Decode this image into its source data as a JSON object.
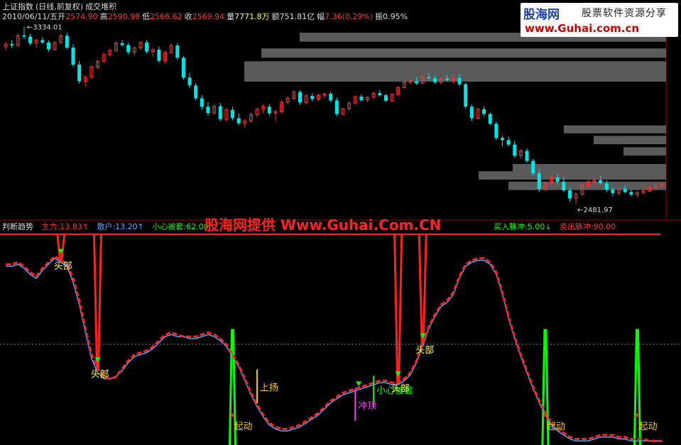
{
  "header": {
    "index_name": "上证指数",
    "mode": "(日线,前复权)",
    "overlay": "成交堆积",
    "date": "2010/06/11/五",
    "open_label": "开",
    "open": "2574.90",
    "high_label": "高",
    "high": "2590.98",
    "low_label": "低",
    "low": "2566.62",
    "close_label": "收",
    "close": "2569.94",
    "volume_label": "量",
    "volume": "7771.8万",
    "amount_label": "额",
    "amount": "751.81亿",
    "change_label": "幅",
    "change": "7.36(0.29%)",
    "amplitude_label": "振",
    "amplitude": "0.95%"
  },
  "logo": {
    "name": "股海网",
    "tagline": "股票软件资源分享",
    "url": "www.Guhai.com.cn"
  },
  "indicator": {
    "name": "判断趋势",
    "main_force_label": "主力",
    "main_force": "13.83↑",
    "retail_label": "散户",
    "retail": "13.20↑",
    "caution_label": "小心被套",
    "caution": "62.00",
    "buy_pulse_label": "买入脉冲",
    "buy_pulse": "5.00↓",
    "sell_pulse_label": "卖出脉冲",
    "sell_pulse": "90.00"
  },
  "watermark": "股海网提供 Www.Guhai.Com.CN",
  "colors": {
    "up": "#ff3030",
    "down": "#00e6e6",
    "main_force": "#ff2020",
    "retail": "#4aa8ff",
    "pulse": "#00ff00",
    "caution": "#ffff00",
    "rise": "#ffcc00",
    "top_text": "#ffff40",
    "magenta": "#ff30ff",
    "volume_profile": "#5a5a5a"
  },
  "chart_data": [
    {
      "type": "candlestick",
      "name": "上证指数",
      "annotations": [
        {
          "text": "3334.01",
          "kind": "high_marker"
        },
        {
          "text": "2481.97",
          "kind": "low_marker"
        }
      ],
      "ohlc": [
        [
          3238,
          3262,
          3222,
          3250
        ],
        [
          3250,
          3270,
          3230,
          3244
        ],
        [
          3244,
          3300,
          3236,
          3292
        ],
        [
          3292,
          3334,
          3275,
          3286
        ],
        [
          3286,
          3300,
          3245,
          3255
        ],
        [
          3255,
          3275,
          3232,
          3270
        ],
        [
          3270,
          3285,
          3250,
          3258
        ],
        [
          3258,
          3268,
          3215,
          3225
        ],
        [
          3225,
          3265,
          3218,
          3258
        ],
        [
          3258,
          3300,
          3250,
          3290
        ],
        [
          3290,
          3305,
          3228,
          3234
        ],
        [
          3234,
          3250,
          3140,
          3152
        ],
        [
          3152,
          3170,
          3060,
          3072
        ],
        [
          3072,
          3100,
          3045,
          3092
        ],
        [
          3092,
          3150,
          3085,
          3140
        ],
        [
          3140,
          3175,
          3128,
          3168
        ],
        [
          3168,
          3210,
          3160,
          3200
        ],
        [
          3200,
          3228,
          3190,
          3220
        ],
        [
          3220,
          3262,
          3212,
          3255
        ],
        [
          3255,
          3270,
          3238,
          3246
        ],
        [
          3246,
          3258,
          3200,
          3212
        ],
        [
          3212,
          3240,
          3196,
          3232
        ],
        [
          3232,
          3265,
          3222,
          3258
        ],
        [
          3258,
          3270,
          3205,
          3215
        ],
        [
          3215,
          3232,
          3190,
          3224
        ],
        [
          3224,
          3240,
          3160,
          3170
        ],
        [
          3170,
          3218,
          3158,
          3210
        ],
        [
          3210,
          3252,
          3204,
          3244
        ],
        [
          3244,
          3258,
          3175,
          3185
        ],
        [
          3185,
          3195,
          3080,
          3090
        ],
        [
          3090,
          3112,
          3040,
          3052
        ],
        [
          3052,
          3065,
          2980,
          2990
        ],
        [
          2990,
          3005,
          2935,
          2950
        ],
        [
          2950,
          2972,
          2905,
          2920
        ],
        [
          2920,
          2960,
          2912,
          2952
        ],
        [
          2952,
          2968,
          2880,
          2890
        ],
        [
          2890,
          2945,
          2878,
          2935
        ],
        [
          2935,
          2950,
          2884,
          2895
        ],
        [
          2895,
          2918,
          2860,
          2870
        ],
        [
          2870,
          2890,
          2850,
          2880
        ],
        [
          2880,
          2920,
          2874,
          2912
        ],
        [
          2912,
          2945,
          2900,
          2938
        ],
        [
          2938,
          2960,
          2920,
          2950
        ],
        [
          2950,
          2962,
          2905,
          2918
        ],
        [
          2918,
          2935,
          2880,
          2925
        ],
        [
          2925,
          2980,
          2918,
          2972
        ],
        [
          2972,
          3000,
          2962,
          2990
        ],
        [
          2990,
          3030,
          2982,
          3020
        ],
        [
          3020,
          3030,
          2960,
          2970
        ],
        [
          2970,
          3010,
          2962,
          3002
        ],
        [
          3002,
          3015,
          2975,
          2986
        ],
        [
          2986,
          3012,
          2978,
          3005
        ],
        [
          3005,
          3018,
          2990,
          3012
        ],
        [
          3012,
          3020,
          2970,
          2980
        ],
        [
          2980,
          2995,
          2905,
          2915
        ],
        [
          2915,
          2945,
          2908,
          2940
        ],
        [
          2940,
          2975,
          2930,
          2968
        ],
        [
          2968,
          3005,
          2960,
          2998
        ],
        [
          2998,
          3010,
          2975,
          2982
        ],
        [
          2982,
          3000,
          2972,
          2995
        ],
        [
          2995,
          3022,
          2988,
          3015
        ],
        [
          3015,
          3030,
          2998,
          3005
        ],
        [
          3005,
          3012,
          2970,
          2978
        ],
        [
          2978,
          3015,
          2972,
          3010
        ],
        [
          3010,
          3048,
          3002,
          3042
        ],
        [
          3042,
          3075,
          3035,
          3068
        ],
        [
          3068,
          3080,
          3055,
          3072
        ],
        [
          3072,
          3092,
          3055,
          3062
        ],
        [
          3062,
          3100,
          3058,
          3092
        ],
        [
          3092,
          3110,
          3082,
          3086
        ],
        [
          3086,
          3100,
          3060,
          3068
        ],
        [
          3068,
          3090,
          3058,
          3085
        ],
        [
          3085,
          3102,
          3070,
          3078
        ],
        [
          3078,
          3092,
          3060,
          3088
        ],
        [
          3088,
          3108,
          3050,
          3058
        ],
        [
          3058,
          3065,
          2940,
          2950
        ],
        [
          2950,
          2960,
          2880,
          2895
        ],
        [
          2895,
          2945,
          2888,
          2938
        ],
        [
          2938,
          2950,
          2905,
          2915
        ],
        [
          2915,
          2922,
          2860,
          2868
        ],
        [
          2868,
          2880,
          2790,
          2800
        ],
        [
          2800,
          2812,
          2760,
          2790
        ],
        [
          2790,
          2805,
          2760,
          2768
        ],
        [
          2768,
          2788,
          2705,
          2715
        ],
        [
          2715,
          2745,
          2700,
          2738
        ],
        [
          2738,
          2750,
          2680,
          2690
        ],
        [
          2690,
          2700,
          2620,
          2630
        ],
        [
          2630,
          2650,
          2540,
          2555
        ],
        [
          2555,
          2592,
          2545,
          2585
        ],
        [
          2585,
          2620,
          2575,
          2610
        ],
        [
          2610,
          2625,
          2575,
          2590
        ],
        [
          2590,
          2610,
          2540,
          2548
        ],
        [
          2548,
          2560,
          2495,
          2510
        ],
        [
          2510,
          2540,
          2485,
          2530
        ],
        [
          2530,
          2580,
          2522,
          2574
        ],
        [
          2574,
          2600,
          2560,
          2590
        ],
        [
          2590,
          2610,
          2565,
          2598
        ],
        [
          2598,
          2620,
          2575,
          2582
        ],
        [
          2582,
          2598,
          2540,
          2552
        ],
        [
          2552,
          2565,
          2520,
          2535
        ],
        [
          2535,
          2560,
          2525,
          2555
        ],
        [
          2555,
          2572,
          2535,
          2540
        ],
        [
          2540,
          2552,
          2520,
          2528
        ],
        [
          2528,
          2545,
          2515,
          2538
        ],
        [
          2538,
          2555,
          2528,
          2545
        ],
        [
          2545,
          2575,
          2540,
          2562
        ],
        [
          2562,
          2590,
          2558,
          2570
        ],
        [
          2570,
          2591,
          2567,
          2575
        ]
      ]
    },
    {
      "type": "line",
      "name": "判断趋势",
      "ylim": [
        0,
        105
      ],
      "series": [
        {
          "name": "主力",
          "values": [
            90,
            90,
            91,
            89,
            86,
            84,
            88,
            91,
            94,
            92,
            90,
            83,
            72,
            58,
            45,
            38,
            34,
            33,
            34,
            38,
            42,
            45,
            46,
            47,
            49,
            52,
            55,
            56,
            55,
            54,
            54,
            54,
            55,
            56,
            55,
            53,
            50,
            45,
            40,
            33,
            26,
            20,
            15,
            11,
            9,
            8,
            8,
            9,
            10,
            12,
            14,
            16,
            19,
            22,
            24,
            26,
            27,
            28,
            29,
            30,
            31,
            32,
            32,
            31,
            31,
            33,
            36,
            42,
            50,
            59,
            65,
            70,
            72,
            76,
            84,
            90,
            92,
            93,
            93,
            91,
            86,
            76,
            64,
            54,
            45,
            37,
            29,
            22,
            16,
            11,
            8,
            6,
            4,
            3,
            3,
            3,
            4,
            5,
            5,
            5,
            4,
            4,
            3,
            3,
            3,
            2,
            2,
            2
          ]
        },
        {
          "name": "散户",
          "values": [
            89,
            89,
            90,
            88,
            85,
            83,
            87,
            90,
            93,
            91,
            89,
            81,
            70,
            56,
            43,
            36,
            33,
            33,
            34,
            37,
            41,
            44,
            45,
            46,
            48,
            51,
            54,
            55,
            54,
            54,
            53,
            53,
            54,
            55,
            54,
            52,
            49,
            44,
            39,
            32,
            25,
            19,
            14,
            10,
            8,
            7,
            7,
            8,
            9,
            11,
            13,
            15,
            18,
            21,
            23,
            25,
            26,
            27,
            28,
            29,
            30,
            31,
            31,
            30,
            30,
            32,
            35,
            41,
            49,
            58,
            64,
            69,
            71,
            75,
            83,
            89,
            91,
            92,
            92,
            90,
            85,
            75,
            63,
            53,
            44,
            36,
            28,
            21,
            15,
            10,
            7,
            5,
            3,
            2,
            2,
            2,
            3,
            4,
            4,
            4,
            3,
            3,
            2,
            2,
            2,
            2,
            2,
            2
          ]
        }
      ],
      "ordering_note": "",
      "labels": [
        {
          "text": "头部",
          "index": 9
        },
        {
          "text": "头部",
          "index": 15
        },
        {
          "text": "上扬",
          "index": 41
        },
        {
          "text": "小心被套",
          "index": 60
        },
        {
          "text": "冲顶",
          "index": 57
        },
        {
          "text": "头部",
          "index": 64
        },
        {
          "text": "头部",
          "index": 68
        },
        {
          "text": "起动",
          "index": 37
        },
        {
          "text": "起动",
          "index": 88
        },
        {
          "text": "起动",
          "index": 103
        }
      ]
    }
  ]
}
